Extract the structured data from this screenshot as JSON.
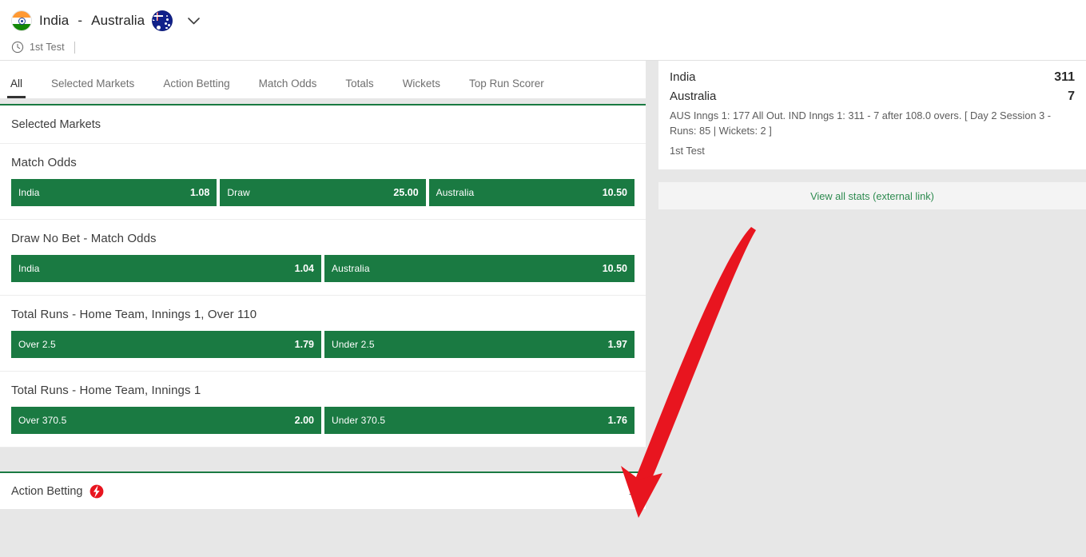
{
  "header": {
    "home_team": "India",
    "separator": "-",
    "away_team": "Australia",
    "home_flag_icon": "india-flag-icon",
    "away_flag_icon": "australia-flag-icon",
    "dropdown_icon": "chevron-down-icon",
    "clock_icon": "clock-icon",
    "match_stage": "1st Test"
  },
  "tabs": [
    {
      "label": "All",
      "active": true
    },
    {
      "label": "Selected Markets",
      "active": false
    },
    {
      "label": "Action Betting",
      "active": false
    },
    {
      "label": "Match Odds",
      "active": false
    },
    {
      "label": "Totals",
      "active": false
    },
    {
      "label": "Wickets",
      "active": false
    },
    {
      "label": "Top Run Scorer",
      "active": false
    }
  ],
  "main": {
    "section_title": "Selected Markets",
    "markets": [
      {
        "name": "Match Odds",
        "columns": 3,
        "selections": [
          {
            "label": "India",
            "odds": "1.08"
          },
          {
            "label": "Draw",
            "odds": "25.00"
          },
          {
            "label": "Australia",
            "odds": "10.50"
          }
        ]
      },
      {
        "name": "Draw No Bet - Match Odds",
        "columns": 2,
        "selections": [
          {
            "label": "India",
            "odds": "1.04"
          },
          {
            "label": "Australia",
            "odds": "10.50"
          }
        ]
      },
      {
        "name": "Total Runs - Home Team, Innings 1, Over 110",
        "columns": 2,
        "selections": [
          {
            "label": "Over 2.5",
            "odds": "1.79"
          },
          {
            "label": "Under 2.5",
            "odds": "1.97"
          }
        ]
      },
      {
        "name": "Total Runs - Home Team, Innings 1",
        "columns": 2,
        "selections": [
          {
            "label": "Over 370.5",
            "odds": "2.00"
          },
          {
            "label": "Under 370.5",
            "odds": "1.76"
          }
        ]
      }
    ]
  },
  "action_betting": {
    "label": "Action Betting",
    "bolt_icon": "lightning-bolt-icon",
    "count": "1"
  },
  "scoreboard": {
    "rows": [
      {
        "team": "India",
        "score": "311"
      },
      {
        "team": "Australia",
        "score": "7"
      }
    ],
    "description": "AUS Inngs 1: 177 All Out. IND Inngs 1: 311 - 7 after 108.0 overs. [ Day 2 Session 3 - Runs: 85 | Wickets: 2 ]",
    "meta": "1st Test",
    "stats_link": "View all stats (external link)"
  },
  "colors": {
    "odds_green": "#1a7a42",
    "accent_green": "#1a7a42",
    "link_green": "#2e8b50",
    "annotation_red": "#e8151f",
    "page_background": "#e7e7e7"
  }
}
